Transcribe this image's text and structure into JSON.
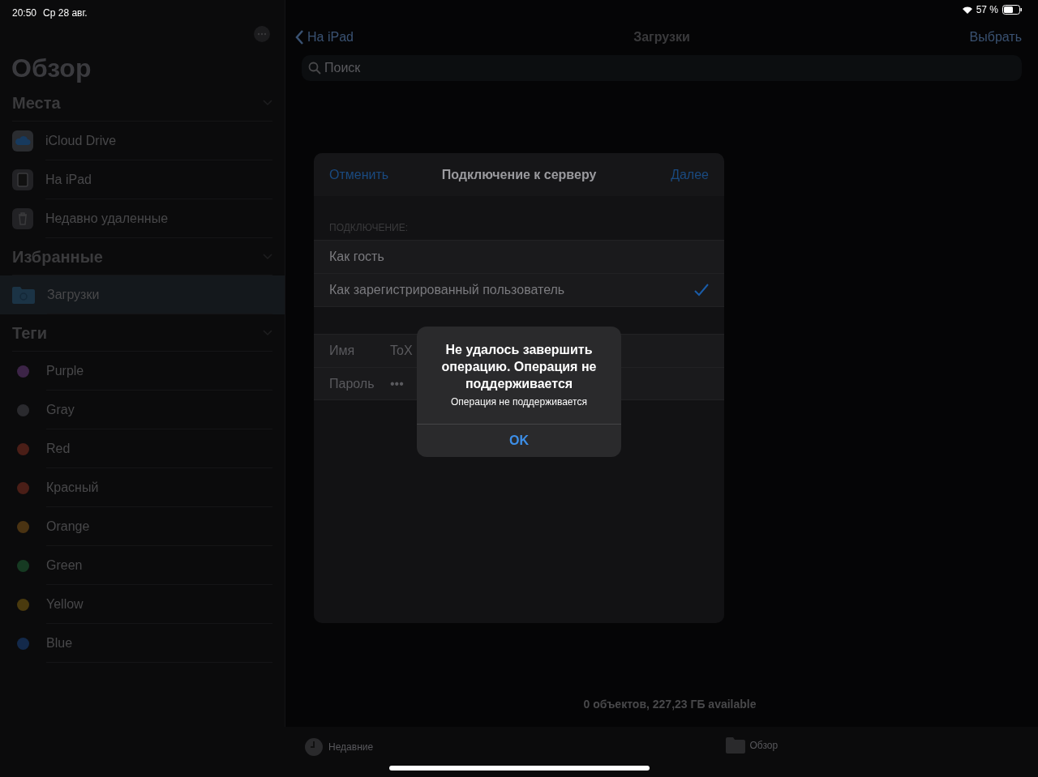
{
  "status_bar": {
    "time": "20:50",
    "date": "Ср 28 авг.",
    "battery": "57 %"
  },
  "sidebar": {
    "title": "Обзор",
    "sections": [
      {
        "title": "Места",
        "items": [
          {
            "label": "iCloud Drive",
            "kind": "icloud",
            "selected": false
          },
          {
            "label": "На iPad",
            "kind": "ipad",
            "selected": false
          },
          {
            "label": "Недавно удаленные",
            "kind": "trash",
            "selected": false
          }
        ]
      },
      {
        "title": "Избранные",
        "items": [
          {
            "label": "Загрузки",
            "kind": "folder",
            "selected": true
          }
        ]
      },
      {
        "title": "Теги",
        "items": [
          {
            "label": "Purple",
            "kind": "tag",
            "color": "#3c2447"
          },
          {
            "label": "Gray",
            "kind": "tag",
            "color": "#2a2a2e"
          },
          {
            "label": "Red",
            "kind": "tag",
            "color": "#4a1e17"
          },
          {
            "label": "Красный",
            "kind": "tag",
            "color": "#4a1e17"
          },
          {
            "label": "Orange",
            "kind": "tag",
            "color": "#4a3312"
          },
          {
            "label": "Green",
            "kind": "tag",
            "color": "#163a22"
          },
          {
            "label": "Yellow",
            "kind": "tag",
            "color": "#4a3a0e"
          },
          {
            "label": "Blue",
            "kind": "tag",
            "color": "#13294a"
          }
        ]
      }
    ]
  },
  "main": {
    "back": "На iPad",
    "title": "Загрузки",
    "action": "Выбрать",
    "search": {
      "placeholder": "Поиск"
    },
    "footer": "0 объектов, 227,23 ГБ available"
  },
  "tab_bar": [
    {
      "label": "Недавние",
      "kind": "clock"
    },
    {
      "label": "Обзор",
      "kind": "folder"
    }
  ],
  "dialog": {
    "cancel": "Отменить",
    "title": "Подключение к серверу",
    "next": "Далее",
    "section_header": "ПОДКЛЮЧЕНИЕ:",
    "options": [
      {
        "label": "Как гость",
        "selected": false
      },
      {
        "label": "Как зарегистрированный пользователь",
        "selected": true
      }
    ],
    "fields": [
      {
        "label": "Имя",
        "value": "ToX"
      },
      {
        "label": "Пароль",
        "value": "•••"
      }
    ]
  },
  "alert": {
    "title": "Не удалось завершить операцию. Операция не поддерживается",
    "message": "Операция не поддерживается",
    "button": "OK"
  }
}
